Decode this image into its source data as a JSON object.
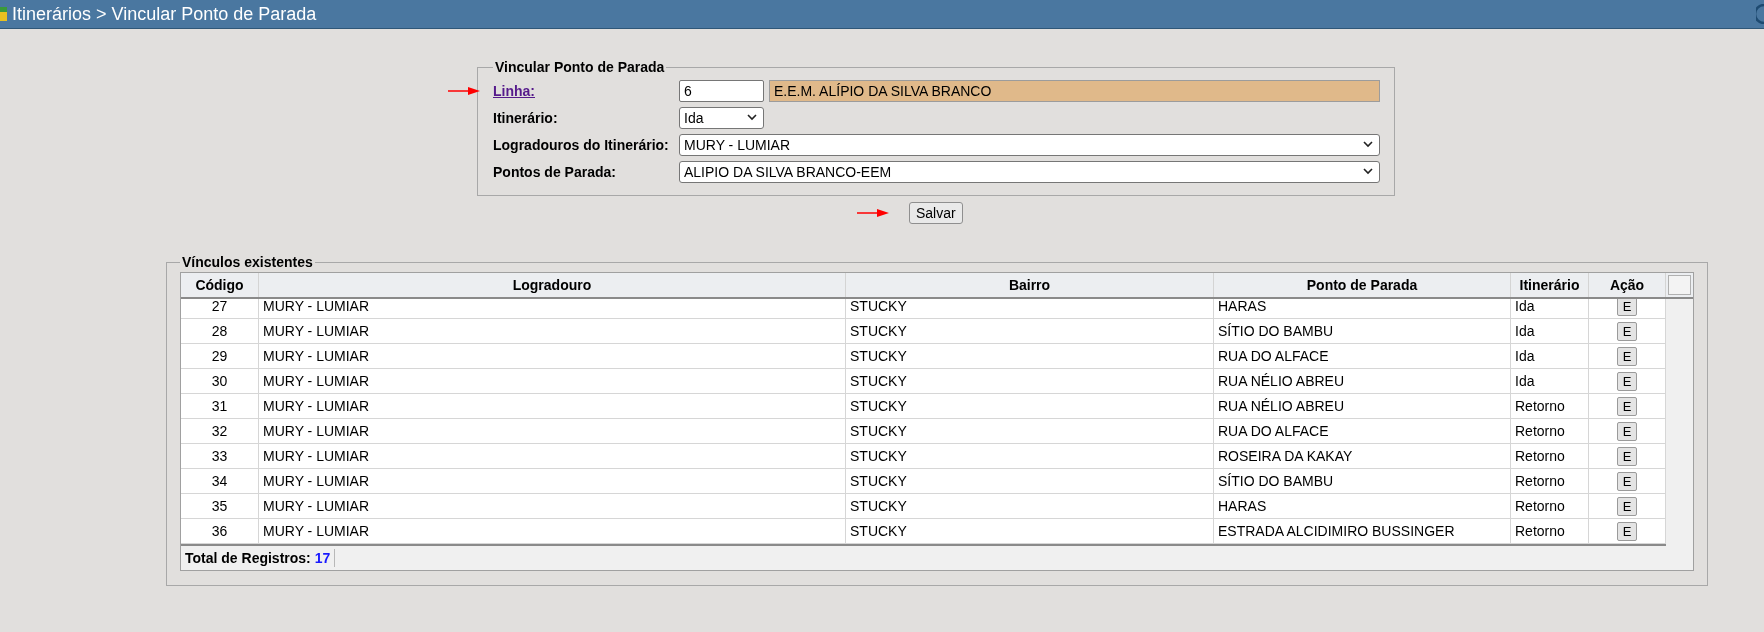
{
  "header": {
    "title": "Itinerários > Vincular Ponto de Parada"
  },
  "form": {
    "legend": "Vincular Ponto de Parada",
    "linha": {
      "label": "Linha:",
      "code": "6",
      "name": "E.E.M. ALÍPIO DA SILVA BRANCO"
    },
    "itinerario": {
      "label": "Itinerário:",
      "value": "Ida"
    },
    "logradouros": {
      "label": "Logradouros do Itinerário:",
      "value": "MURY - LUMIAR"
    },
    "pontos": {
      "label": "Pontos de Parada:",
      "value": "ALIPIO DA SILVA BRANCO-EEM"
    },
    "save_button": "Salvar"
  },
  "table": {
    "legend": "Vínculos existentes",
    "columns": [
      "Código",
      "Logradouro",
      "Bairro",
      "Ponto de Parada",
      "Itinerário",
      "Ação"
    ],
    "rows": [
      {
        "codigo": "27",
        "logradouro": "MURY - LUMIAR",
        "bairro": "STUCKY",
        "ponto": "HARAS",
        "itinerario": "Ida",
        "acao": "E"
      },
      {
        "codigo": "28",
        "logradouro": "MURY - LUMIAR",
        "bairro": "STUCKY",
        "ponto": "SÍTIO DO BAMBU",
        "itinerario": "Ida",
        "acao": "E"
      },
      {
        "codigo": "29",
        "logradouro": "MURY - LUMIAR",
        "bairro": "STUCKY",
        "ponto": "RUA DO ALFACE",
        "itinerario": "Ida",
        "acao": "E"
      },
      {
        "codigo": "30",
        "logradouro": "MURY - LUMIAR",
        "bairro": "STUCKY",
        "ponto": "RUA NÉLIO ABREU",
        "itinerario": "Ida",
        "acao": "E"
      },
      {
        "codigo": "31",
        "logradouro": "MURY - LUMIAR",
        "bairro": "STUCKY",
        "ponto": "RUA NÉLIO ABREU",
        "itinerario": "Retorno",
        "acao": "E"
      },
      {
        "codigo": "32",
        "logradouro": "MURY - LUMIAR",
        "bairro": "STUCKY",
        "ponto": "RUA DO ALFACE",
        "itinerario": "Retorno",
        "acao": "E"
      },
      {
        "codigo": "33",
        "logradouro": "MURY - LUMIAR",
        "bairro": "STUCKY",
        "ponto": "ROSEIRA DA KAKAY",
        "itinerario": "Retorno",
        "acao": "E"
      },
      {
        "codigo": "34",
        "logradouro": "MURY - LUMIAR",
        "bairro": "STUCKY",
        "ponto": "SÍTIO DO BAMBU",
        "itinerario": "Retorno",
        "acao": "E"
      },
      {
        "codigo": "35",
        "logradouro": "MURY - LUMIAR",
        "bairro": "STUCKY",
        "ponto": "HARAS",
        "itinerario": "Retorno",
        "acao": "E"
      },
      {
        "codigo": "36",
        "logradouro": "MURY - LUMIAR",
        "bairro": "STUCKY",
        "ponto": "ESTRADA ALCIDIMIRO BUSSINGER",
        "itinerario": "Retorno",
        "acao": "E"
      }
    ],
    "footer": {
      "label": "Total de Registros:",
      "value": "17"
    }
  }
}
